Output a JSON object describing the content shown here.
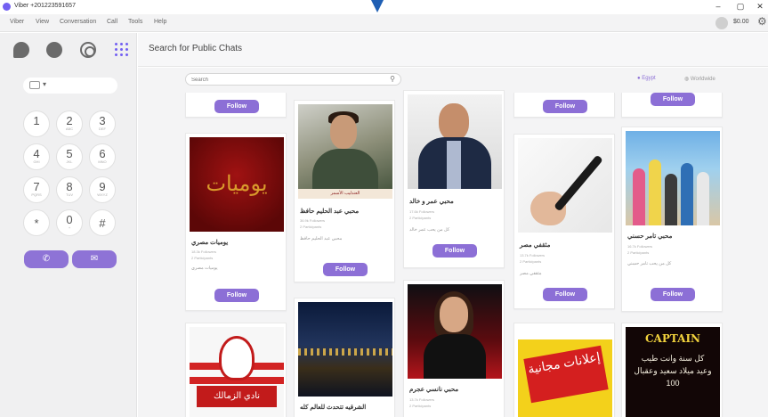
{
  "window": {
    "title": "Viber +201223591657",
    "minimize": "–",
    "maximize": "▢",
    "close": "✕"
  },
  "menu": {
    "items": [
      "Viber",
      "View",
      "Conversation",
      "Call",
      "Tools",
      "Help"
    ],
    "balance": "$0.00"
  },
  "header": {
    "title": "Search for Public Chats"
  },
  "search": {
    "placeholder": "Search"
  },
  "location": {
    "egypt": "Egypt",
    "worldwide": "Worldwide"
  },
  "dialpad": {
    "keys": [
      {
        "digit": "1",
        "letters": ""
      },
      {
        "digit": "2",
        "letters": "ABC"
      },
      {
        "digit": "3",
        "letters": "DEF"
      },
      {
        "digit": "4",
        "letters": "GHI"
      },
      {
        "digit": "5",
        "letters": "JKL"
      },
      {
        "digit": "6",
        "letters": "MNO"
      },
      {
        "digit": "7",
        "letters": "PQRS"
      },
      {
        "digit": "8",
        "letters": "TUV"
      },
      {
        "digit": "9",
        "letters": "WXYZ"
      },
      {
        "digit": "*",
        "letters": ""
      },
      {
        "digit": "0",
        "letters": "+"
      },
      {
        "digit": "#",
        "letters": ""
      }
    ]
  },
  "follow_label": "Follow",
  "cards": [
    {
      "name": "يوميات مصري",
      "followers": "18.3k Followers",
      "participants": "2 Participants",
      "desc": "يوميات مصري"
    },
    {
      "name": "محبي عبد الحليم حافظ",
      "followers": "36.9k Followers",
      "participants": "2 Participants",
      "desc": "محبي عبد الحليم حافظ"
    },
    {
      "name": "محبي عمر و خالد",
      "followers": "17.6k Followers",
      "participants": "2 Participants",
      "desc": "كل من يحب عمر خالد"
    },
    {
      "name": "مثقفي مصر",
      "followers": "13.7k Followers",
      "participants": "2 Participants",
      "desc": "مثقفي مصر"
    },
    {
      "name": "محبي تامر حسني",
      "followers": "16.7k Followers",
      "participants": "2 Participants",
      "desc": "كل من يحب تامر حسني"
    },
    {
      "name": "",
      "followers": "",
      "participants": "",
      "desc": ""
    },
    {
      "name": "الشرقيه تتحدث للعالم كله",
      "followers": "",
      "participants": "",
      "desc": ""
    },
    {
      "name": "محبي نانسي عجرم",
      "followers": "13.7k Followers",
      "participants": "2 Participants",
      "desc": ""
    },
    {
      "name": "",
      "followers": "",
      "participants": "",
      "desc": ""
    },
    {
      "name": "",
      "followers": "",
      "participants": "",
      "desc": ""
    }
  ],
  "images": {
    "yawmiyat": "يوميات",
    "halim_strip": "العندليب الأسمر",
    "zamalek": "نادي الزمالك",
    "ads": "إعلانات مجانية",
    "captain_title": "CAPTAIN",
    "captain_text": "كل سنة وانت طيب وعيد ميلاد سعيد وعقبال 100"
  },
  "colors": {
    "accent": "#8c6fd6",
    "viber": "#7360f2"
  }
}
